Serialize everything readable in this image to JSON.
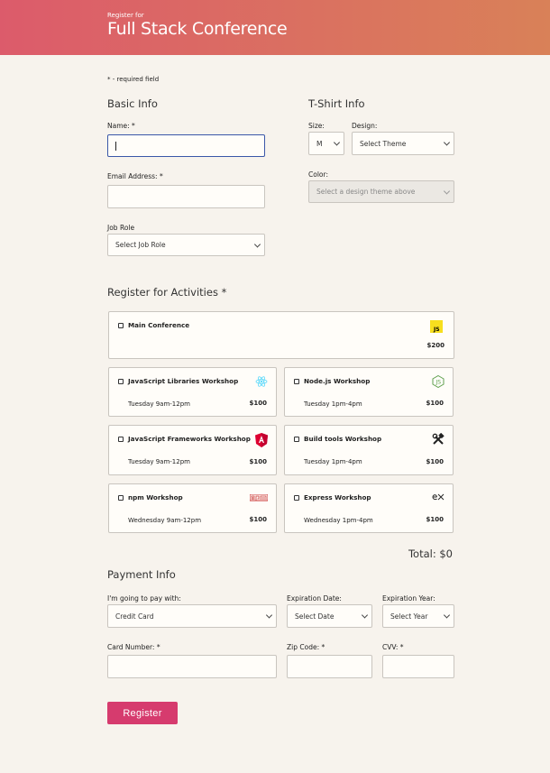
{
  "header": {
    "subtitle": "Register for",
    "title": "Full Stack Conference"
  },
  "required_note": "* - required field",
  "basic_info": {
    "title": "Basic Info",
    "name_label": "Name: *",
    "name_value": "",
    "email_label": "Email Address: *",
    "email_value": "",
    "job_role_label": "Job Role",
    "job_role_selected": "Select Job Role"
  },
  "tshirt_info": {
    "title": "T-Shirt Info",
    "size_label": "Size:",
    "size_selected": "M",
    "design_label": "Design:",
    "design_selected": "Select Theme",
    "color_label": "Color:",
    "color_selected": "Select a design theme above"
  },
  "activities": {
    "title": "Register for Activities *",
    "items": [
      {
        "name": "Main Conference",
        "time": "",
        "price": "$200",
        "icon": "javascript-icon"
      },
      {
        "name": "JavaScript Libraries Workshop",
        "time": "Tuesday 9am-12pm",
        "price": "$100",
        "icon": "react-icon"
      },
      {
        "name": "Node.js Workshop",
        "time": "Tuesday 1pm-4pm",
        "price": "$100",
        "icon": "nodejs-icon"
      },
      {
        "name": "JavaScript Frameworks Workshop",
        "time": "Tuesday 9am-12pm",
        "price": "$100",
        "icon": "angular-icon"
      },
      {
        "name": "Build tools Workshop",
        "time": "Tuesday 1pm-4pm",
        "price": "$100",
        "icon": "hammer-wrench-icon"
      },
      {
        "name": "npm Workshop",
        "time": "Wednesday 9am-12pm",
        "price": "$100",
        "icon": "npm-icon"
      },
      {
        "name": "Express Workshop",
        "time": "Wednesday 1pm-4pm",
        "price": "$100",
        "icon": "express-icon"
      }
    ],
    "total": "Total: $0"
  },
  "payment": {
    "title": "Payment Info",
    "method_label": "I'm going to pay with:",
    "method_selected": "Credit Card",
    "exp_date_label": "Expiration Date:",
    "exp_date_selected": "Select Date",
    "exp_year_label": "Expiration Year:",
    "exp_year_selected": "Select Year",
    "card_label": "Card Number: *",
    "zip_label": "Zip Code: *",
    "cvv_label": "CVV: *"
  },
  "register_button": "Register",
  "colors": {
    "accent": "#d63b6e",
    "header_start": "#dc5b6b",
    "header_end": "#d98158",
    "focus": "#3a57a8"
  }
}
